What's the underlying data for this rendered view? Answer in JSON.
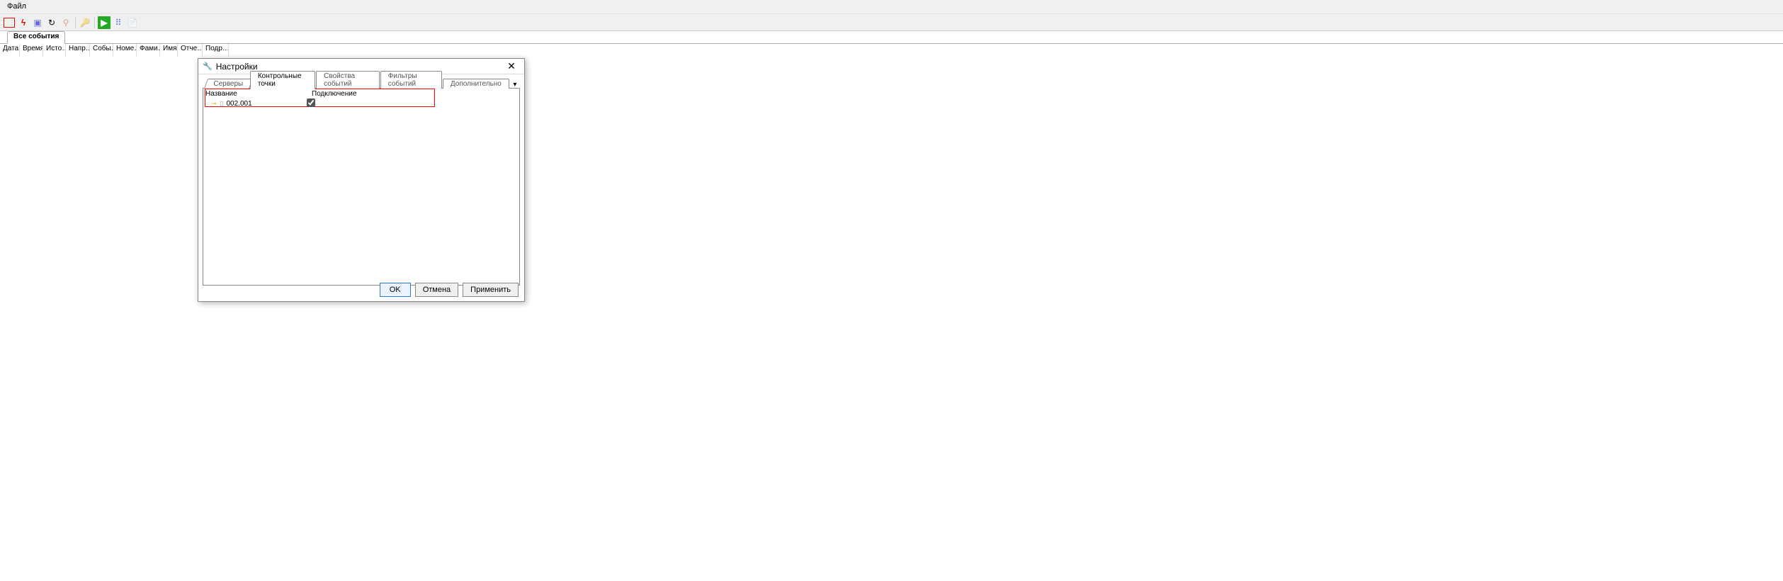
{
  "menu": {
    "file": "Файл"
  },
  "main_tab": "Все события",
  "columns": [
    "Дата",
    "Время",
    "Исто…",
    "Напр…",
    "Собы…",
    "Номе…",
    "Фами…",
    "Имя",
    "Отче…",
    "Подр…"
  ],
  "dialog": {
    "title": "Настройки",
    "tabs": [
      "Серверы",
      "Контрольные точки",
      "Свойства событий",
      "Фильтры событий",
      "Дополнительно"
    ],
    "active_tab_index": 1,
    "grid_headers": {
      "name": "Название",
      "conn": "Подключение"
    },
    "row": {
      "label": "002.001",
      "checked": true
    },
    "buttons": {
      "ok": "OK",
      "cancel": "Отмена",
      "apply": "Применить"
    }
  }
}
